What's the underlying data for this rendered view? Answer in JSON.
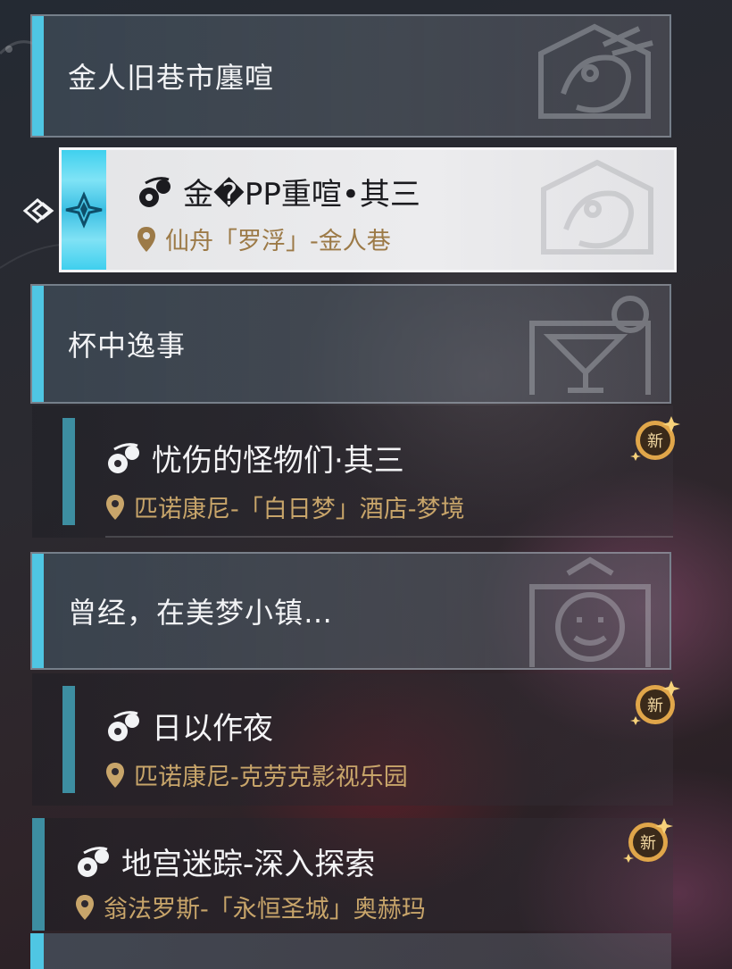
{
  "groups": [
    {
      "title": "金人旧巷市廛喧",
      "emblem": "bird-emblem-icon"
    },
    {
      "title": "杯中逸事",
      "emblem": "cocktail-emblem-icon"
    },
    {
      "title": "曾经，在美梦小镇…",
      "emblem": "clock-emblem-icon"
    }
  ],
  "selected_quest": {
    "title": "金�PP重喧•其三",
    "location": "仙舟「罗浮」-金人巷",
    "icon": "quest-icon",
    "location_icon": "map-pin-icon"
  },
  "quests": [
    {
      "title": "忧伤的怪物们·其三",
      "location": "匹诺康尼-「白日梦」酒店-梦境",
      "badge": "新"
    },
    {
      "title": "日以作夜",
      "location": "匹诺康尼-克劳克影视乐园",
      "badge": "新"
    },
    {
      "title": "地宫迷踪-深入探索",
      "location": "翁法罗斯-「永恒圣城」奥赫玛",
      "badge": "新"
    }
  ],
  "colors": {
    "accent": "#4fc6e3",
    "location_text": "#c8a56a",
    "badge": "#e0a64a"
  }
}
